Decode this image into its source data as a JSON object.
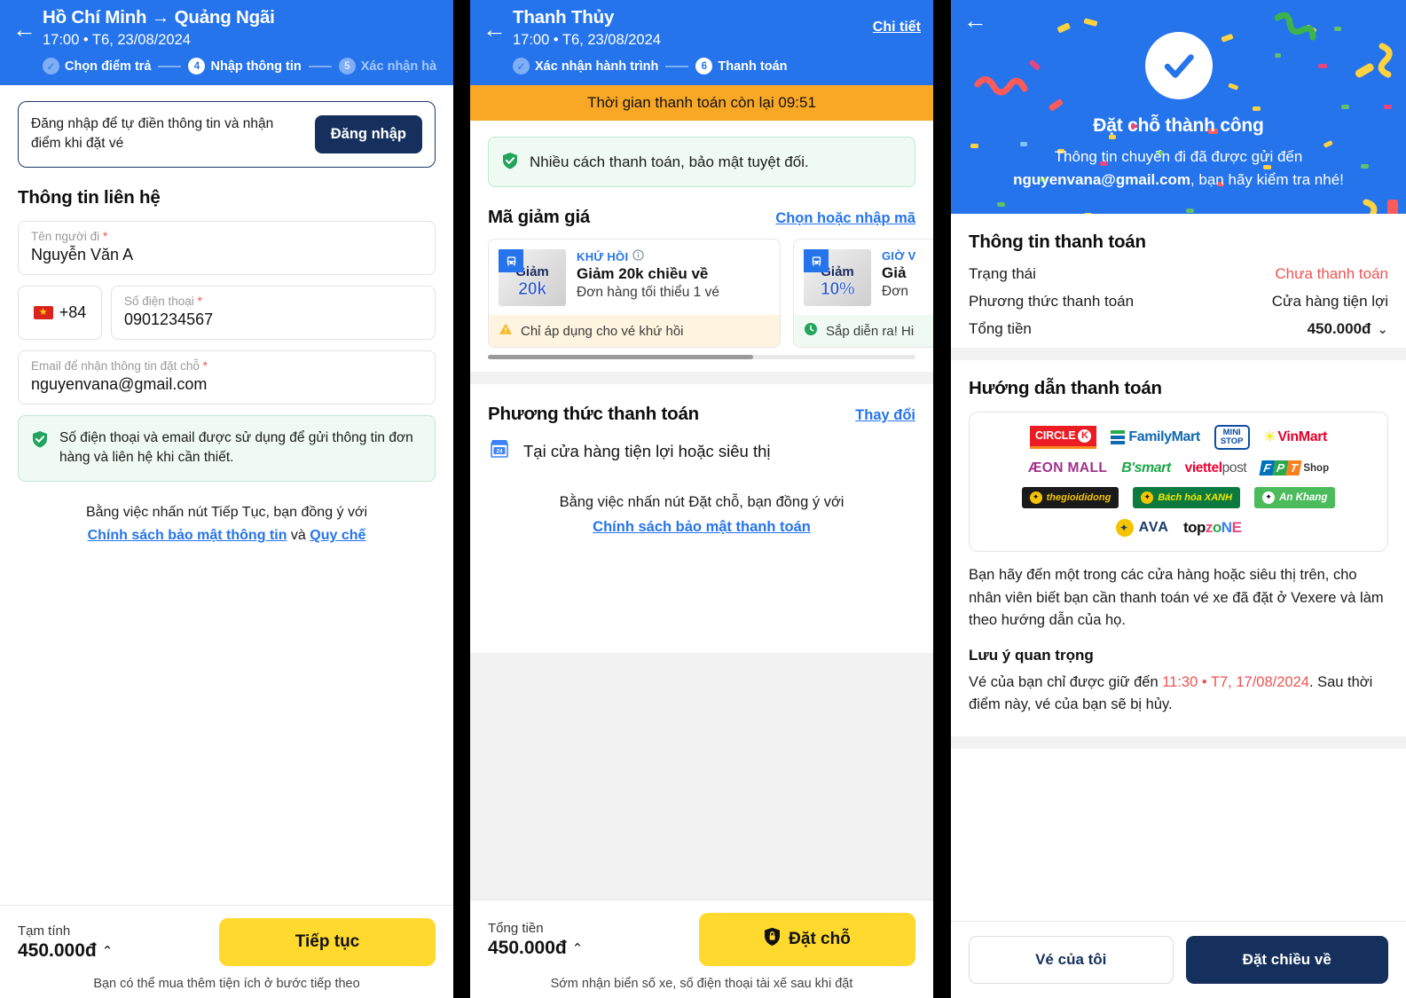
{
  "panel1": {
    "header": {
      "back_icon": "arrow-left-icon",
      "title": "Hồ Chí Minh → Quảng Ngãi",
      "subtitle": "17:00 • T6, 23/08/2024",
      "steps": [
        {
          "num": "✓",
          "label": "Chọn điểm trả",
          "state": "done"
        },
        {
          "num": "4",
          "label": "Nhập thông tin",
          "state": "active"
        },
        {
          "num": "5",
          "label": "Xác nhận hà",
          "state": "todo"
        }
      ]
    },
    "login": {
      "text": "Đăng nhập để tự điền thông tin và nhận điểm khi đặt vé",
      "button": "Đăng nhập"
    },
    "contact_title": "Thông tin liên hệ",
    "fields": {
      "name_label": "Tên người đi",
      "name_value": "Nguyễn Văn A",
      "country_code": "+84",
      "phone_label": "Số điện thoại",
      "phone_value": "0901234567",
      "email_label": "Email để nhận thông tin đặt chỗ",
      "email_value": "nguyenvana@gmail.com",
      "required_mark": "*"
    },
    "green_note": "Số điện thoại và email được sử dụng để gửi thông tin đơn hàng và liên hệ khi cần thiết.",
    "agree_prefix": "Bằng việc nhấn nút Tiếp Tục, bạn đồng ý với",
    "agree_link1": "Chính sách bảo mật thông tin",
    "agree_mid": " và ",
    "agree_link2": "Quy chế",
    "bottom": {
      "label": "Tạm tính",
      "price": "450.000đ",
      "caret": "⌃",
      "cta": "Tiếp tục",
      "hint": "Bạn có thể mua thêm tiện ích ở bước tiếp theo"
    }
  },
  "panel2": {
    "header": {
      "back_icon": "arrow-left-icon",
      "title": "Thanh Thủy",
      "subtitle": "17:00 • T6, 23/08/2024",
      "detail_link": "Chi tiết",
      "steps": [
        {
          "num": "✓",
          "label": "Xác nhận hành trình",
          "state": "done"
        },
        {
          "num": "6",
          "label": "Thanh toán",
          "state": "active"
        }
      ]
    },
    "timer": "Thời gian thanh toán còn lại 09:51",
    "secure_banner": "Nhiều cách thanh toán, bảo mật tuyệt đối.",
    "voucher_section": {
      "title": "Mã giảm giá",
      "action": "Chọn hoặc nhập mã",
      "cards": [
        {
          "thumb_line1": "Giảm",
          "thumb_line2": "20k",
          "tag": "KHỨ HỒI",
          "tag_icon": "info-icon",
          "name": "Giảm 20k chiều về",
          "desc": "Đơn hàng tối thiểu 1 vé",
          "foot_icon": "warning-icon",
          "foot": "Chỉ áp dụng cho vé khứ hồi",
          "foot_type": "warn"
        },
        {
          "thumb_line1": "Giảm",
          "thumb_line2": "10%",
          "tag": "GIỜ V",
          "tag_icon": "info-icon",
          "name": "Giả",
          "desc": "Đơn",
          "foot_icon": "clock-icon",
          "foot": "Sắp diễn ra! Hi",
          "foot_type": "info"
        }
      ]
    },
    "payment_section": {
      "title": "Phương thức thanh toán",
      "action": "Thay đổi",
      "method_icon": "convenience-store-icon",
      "method": "Tại cửa hàng tiện lợi hoặc siêu thị",
      "agree_prefix": "Bằng việc nhấn nút Đặt chỗ, bạn đồng ý với",
      "agree_link": "Chính sách bảo mật thanh toán"
    },
    "bottom": {
      "label": "Tổng tiền",
      "price": "450.000đ",
      "caret": "⌃",
      "cta_icon": "lock-icon",
      "cta": "Đặt chỗ",
      "hint": "Sớm nhận biển số xe, số điện thoại tài xế sau khi đặt"
    }
  },
  "panel3": {
    "header": {
      "back_icon": "arrow-left-icon",
      "check_icon": "check-circle-icon",
      "title": "Đặt chỗ thành công",
      "sub_prefix": "Thông tin chuyến đi đã được gửi đến",
      "email": "nguyenvana@gmail.com",
      "sub_suffix": ", bạn hãy kiểm tra nhé!"
    },
    "payment_info": {
      "title": "Thông tin thanh toán",
      "rows": [
        {
          "key": "Trạng thái",
          "value": "Chưa thanh toán",
          "style": "red"
        },
        {
          "key": "Phương thức thanh toán",
          "value": "Cửa hàng tiện lợi",
          "style": "normal"
        },
        {
          "key": "Tổng tiền",
          "value": "450.000đ",
          "style": "bold",
          "caret": "⌄"
        }
      ]
    },
    "guide": {
      "title": "Hướng dẫn thanh toán",
      "logos": [
        [
          "CIRCLE K",
          "FamilyMart",
          "MINI STOP",
          "VinMart"
        ],
        [
          "AEON MALL",
          "B'smart",
          "viettel post",
          "FPT Shop"
        ],
        [
          "thegioididong",
          "Bách hóa XANH",
          "An Khang"
        ],
        [
          "AVA",
          "topzone"
        ]
      ],
      "paragraph": "Bạn hãy đến một trong các cửa hàng hoặc siêu thị trên, cho nhân viên biết bạn cần thanh toán vé xe đã đặt ở Vexere và làm theo hướng dẫn của họ.",
      "note_title": "Lưu ý quan trọng",
      "note_prefix": "Vé của bạn chỉ được giữ đến ",
      "note_deadline": "11:30 • T7, 17/08/2024",
      "note_suffix": ". Sau thời điểm này, vé của bạn sẽ bị hủy."
    },
    "bottom": {
      "secondary": "Vé của tôi",
      "primary": "Đặt chiều về"
    }
  },
  "colors": {
    "brand_blue": "#2574EC",
    "navy": "#15305C",
    "yellow": "#FFD92E",
    "orange": "#F9A826",
    "red": "#F05252",
    "green": "#22A45D"
  }
}
